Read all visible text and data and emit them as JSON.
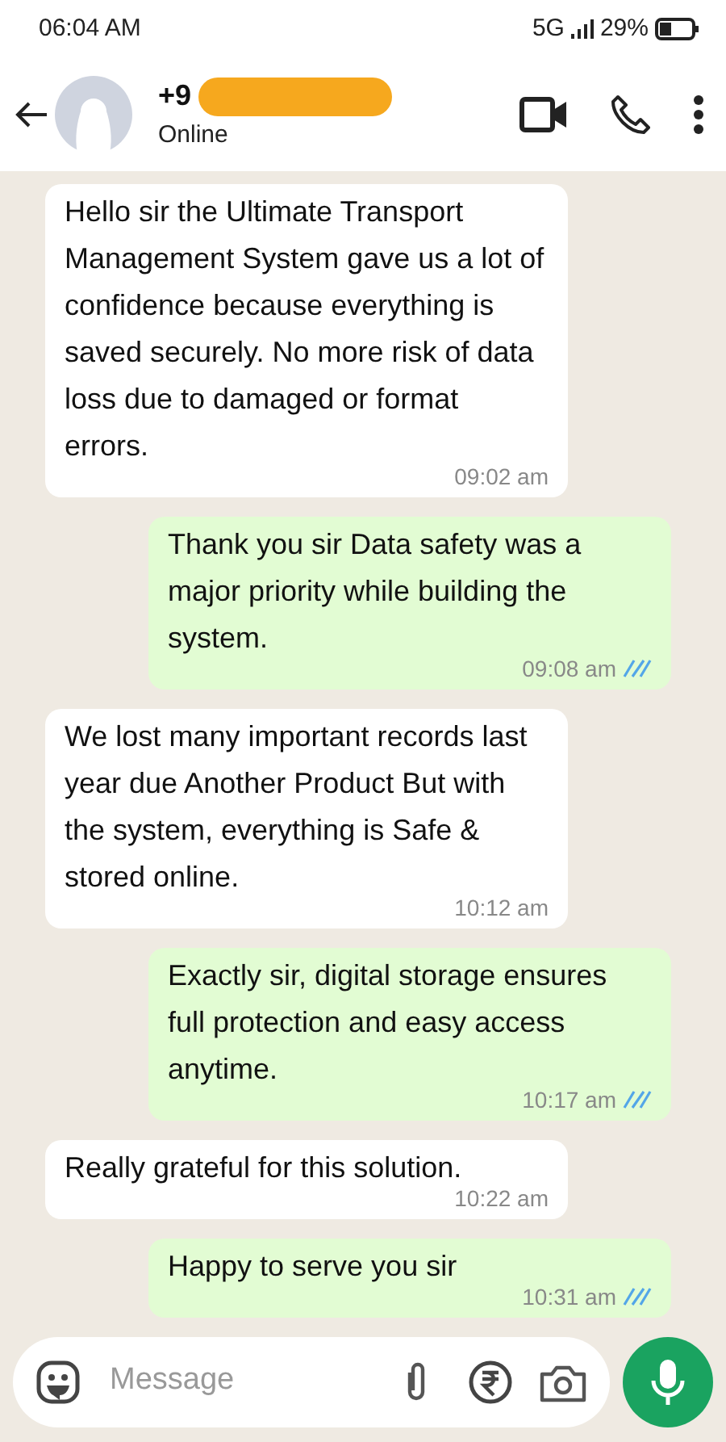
{
  "status_bar": {
    "time": "06:04 AM",
    "network": "5G",
    "battery": "29%"
  },
  "header": {
    "contact": "+9",
    "presence": "Online"
  },
  "messages": [
    {
      "kind": "received",
      "text": "Hello sir the Ultimate Transport Management System gave us a lot of confidence because everything is saved securely. No more risk of data loss due to damaged or format errors.",
      "time": "09:02 am"
    },
    {
      "kind": "sent",
      "text": "Thank you sir Data safety was a major priority while building the system.",
      "time": "09:08 am",
      "read": true
    },
    {
      "kind": "received",
      "text": "We lost many important records last year due Another Product But with the system, everything is Safe & stored online.",
      "time": "10:12 am"
    },
    {
      "kind": "sent",
      "text": "Exactly sir, digital storage ensures full protection and easy access anytime.",
      "time": "10:17 am",
      "read": true
    },
    {
      "kind": "received",
      "text": "Really grateful for this solution.",
      "time": "10:22 am"
    },
    {
      "kind": "sent",
      "text": "Happy to serve you sir",
      "time": "10:31 am",
      "read": true
    }
  ],
  "composer": {
    "placeholder": "Message"
  }
}
